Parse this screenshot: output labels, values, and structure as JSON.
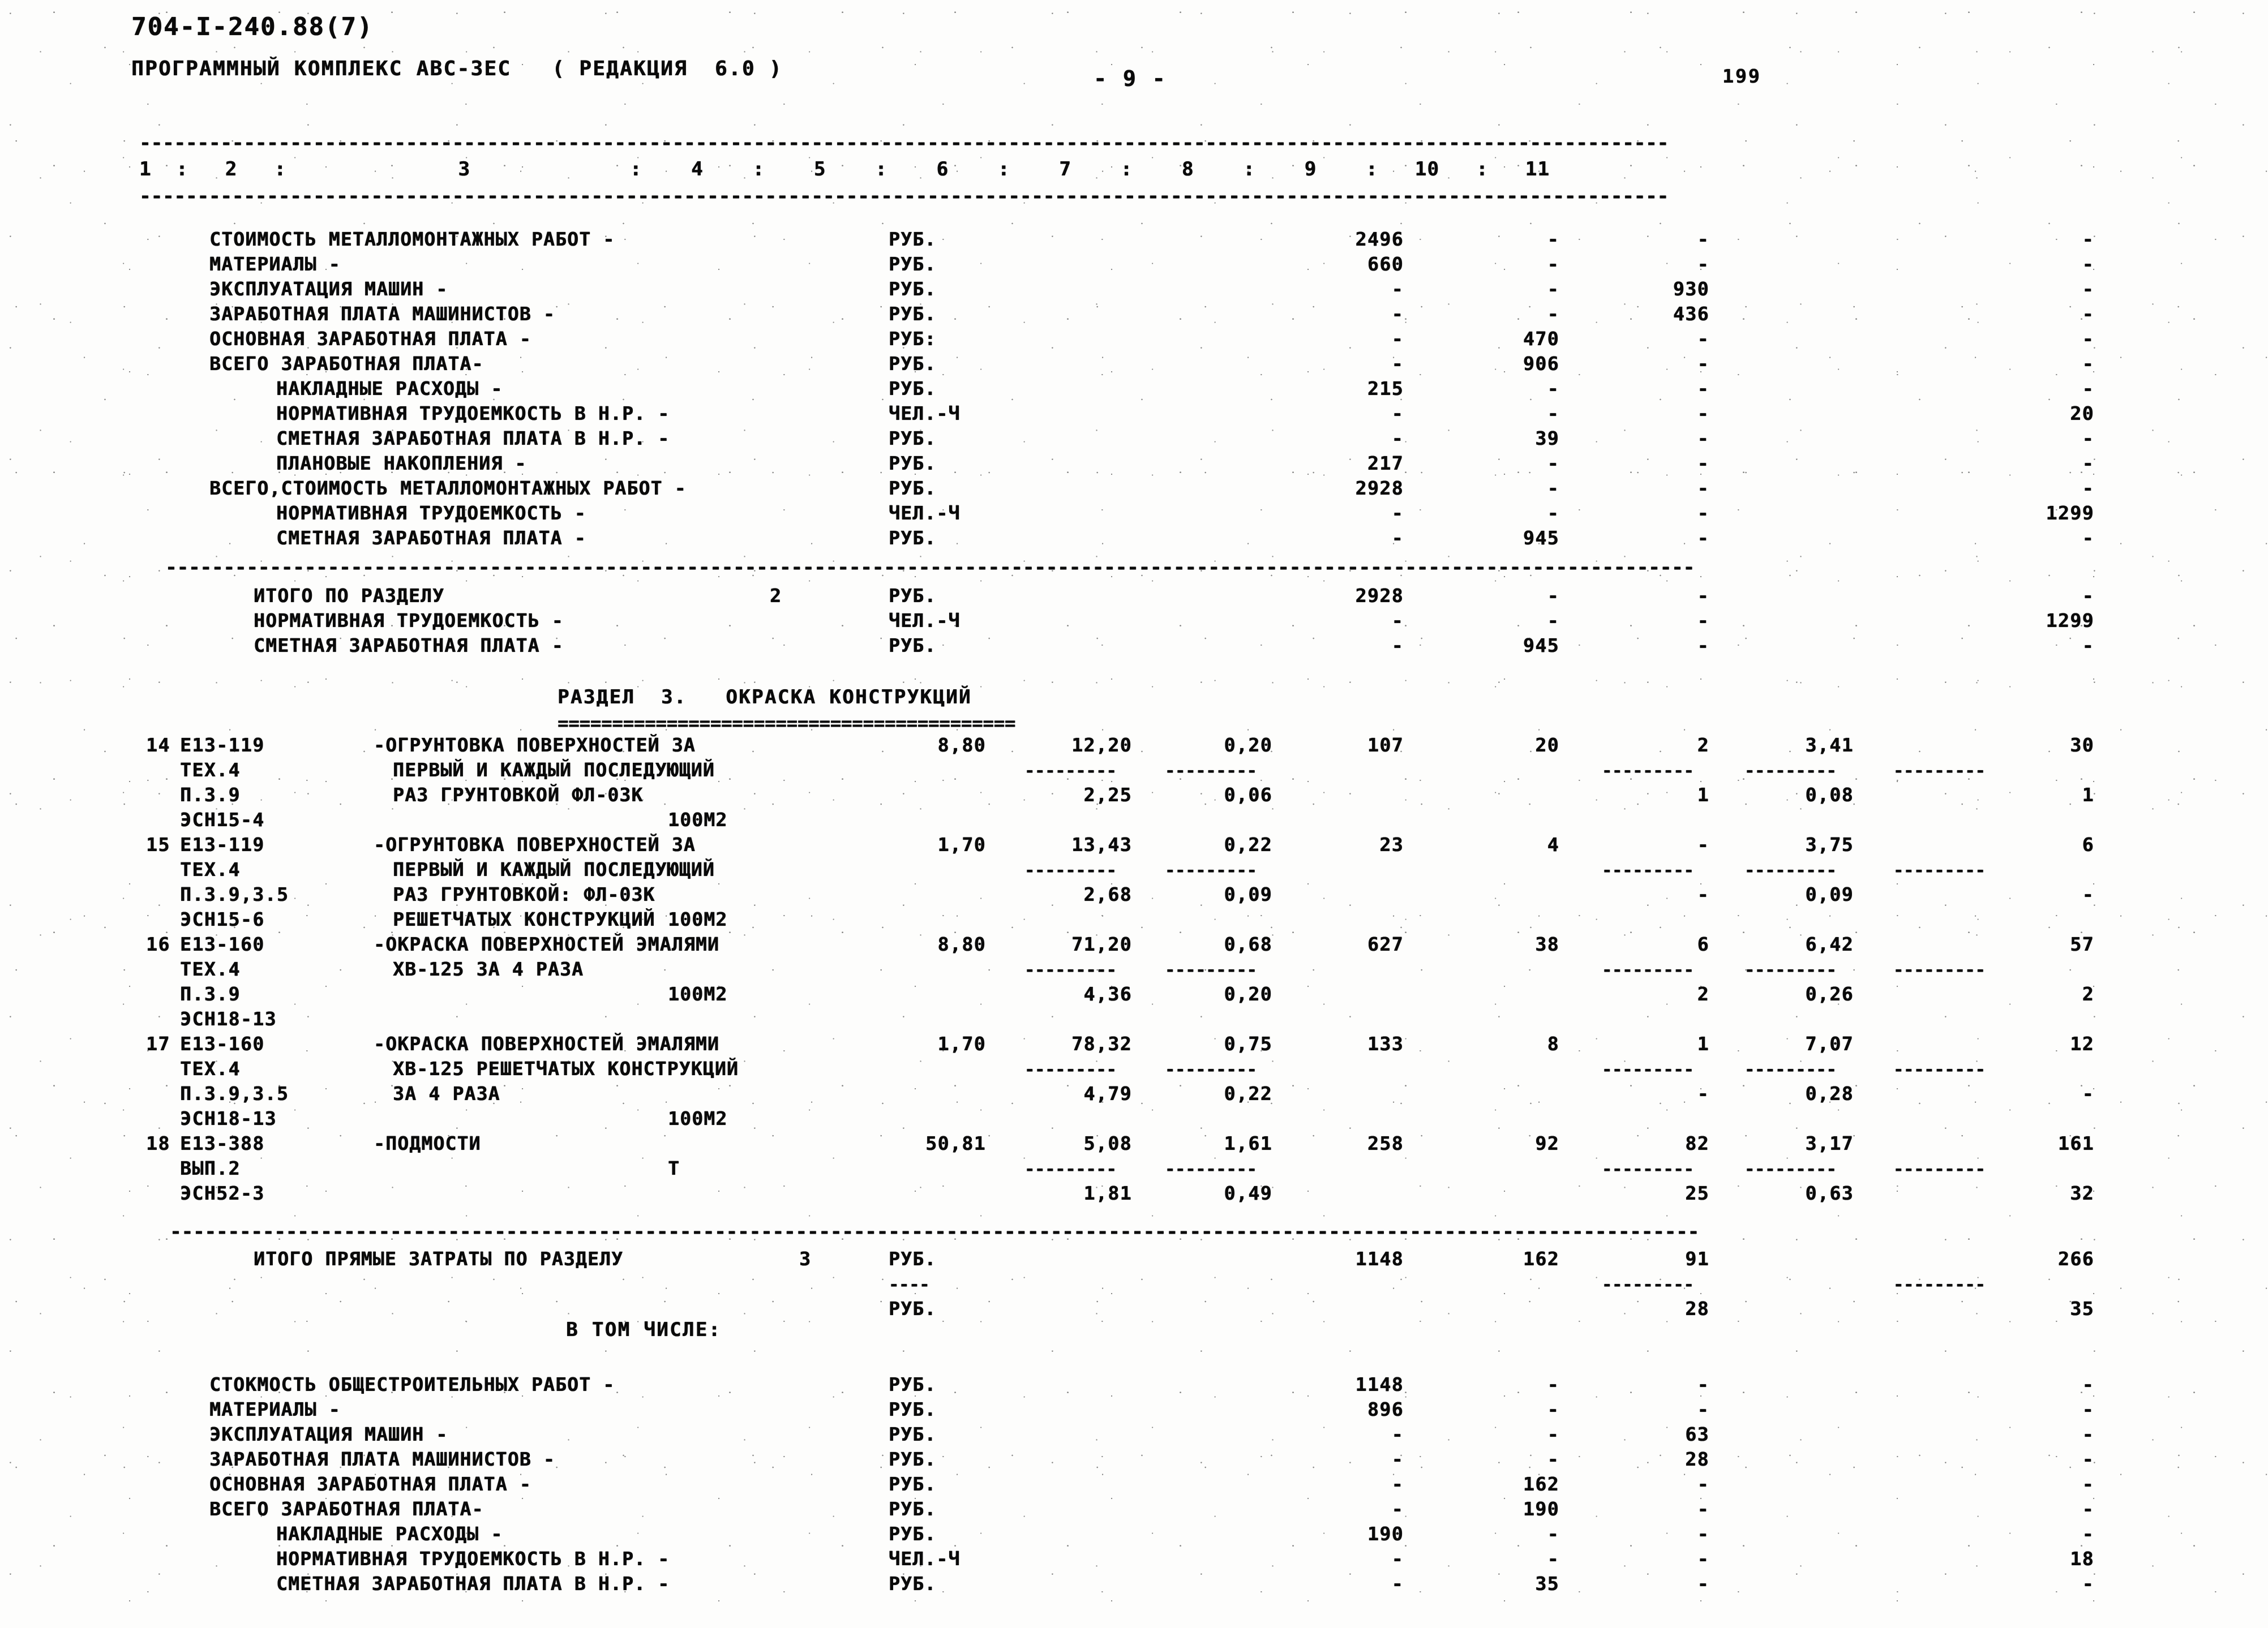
{
  "header": {
    "doc_code": "704-I-240.88(7)",
    "program_line": "ПРОГРАММНЫЙ КОМПЛЕКС АВС-3ЕС   ( РЕДАКЦИЯ  6.0 )",
    "page_marker": "- 9 -",
    "sheet_number": "199"
  },
  "column_numbers": "1  :   2   :              3             :    4    :    5    :    6    :    7    :    8    :    9    :   10   :   11",
  "rules": {
    "top": "------------------------------------------------------------------------------------------------------------------------------------",
    "eq": "==========================================",
    "dash_short": "---------",
    "short_dots": "----"
  },
  "block_metalwork": {
    "title": "",
    "lines": [
      {
        "label": "СТОИМОСТЬ МЕТАЛЛОМОНТАЖНЫХ РАБОТ -",
        "indent": 0,
        "unit": "РУБ.",
        "c7": "2496",
        "c8": "-",
        "c9": "-",
        "c10": "",
        "c11": "-"
      },
      {
        "label": "МАТЕРИАЛЫ -",
        "indent": 0,
        "unit": "РУБ.",
        "c7": "660",
        "c8": "-",
        "c9": "-",
        "c10": "",
        "c11": "-"
      },
      {
        "label": "ЭКСПЛУАТАЦИЯ МАШИН -",
        "indent": 0,
        "unit": "РУБ.",
        "c7": "-",
        "c8": "-",
        "c9": "930",
        "c10": "",
        "c11": "-"
      },
      {
        "label": "ЗАРАБОТНАЯ ПЛАТА МАШИНИСТОВ -",
        "indent": 0,
        "unit": "РУБ.",
        "c7": "-",
        "c8": "-",
        "c9": "436",
        "c10": "",
        "c11": "-"
      },
      {
        "label": "ОСНОВНАЯ ЗАРАБОТНАЯ ПЛАТА -",
        "indent": 0,
        "unit": "РУБ:",
        "c7": "-",
        "c8": "470",
        "c9": "-",
        "c10": "",
        "c11": "-"
      },
      {
        "label": "ВСЕГО ЗАРАБОТНАЯ ПЛАТА-",
        "indent": 0,
        "unit": "РУБ.",
        "c7": "-",
        "c8": "906",
        "c9": "-",
        "c10": "",
        "c11": "-"
      },
      {
        "label": "НАКЛАДНЫЕ РАСХОДЫ -",
        "indent": 1,
        "unit": "РУБ.",
        "c7": "215",
        "c8": "-",
        "c9": "-",
        "c10": "",
        "c11": "-"
      },
      {
        "label": "НОРМАТИВНАЯ ТРУДОЕМКОСТЬ В Н.Р. -",
        "indent": 1,
        "unit": "ЧЕЛ.-Ч",
        "c7": "-",
        "c8": "-",
        "c9": "-",
        "c10": "",
        "c11": "20"
      },
      {
        "label": "СМЕТНАЯ ЗАРАБОТНАЯ ПЛАТА В Н.Р. -",
        "indent": 1,
        "unit": "РУБ.",
        "c7": "-",
        "c8": "39",
        "c9": "-",
        "c10": "",
        "c11": "-"
      },
      {
        "label": "ПЛАНОВЫЕ НАКОПЛЕНИЯ -",
        "indent": 1,
        "unit": "РУБ.",
        "c7": "217",
        "c8": "-",
        "c9": "-",
        "c10": "",
        "c11": "-"
      },
      {
        "label": "ВСЕГО,СТОИМОСТЬ МЕТАЛЛОМОНТАЖНЫХ РАБОТ -",
        "indent": 0,
        "unit": "РУБ.",
        "c7": "2928",
        "c8": "-",
        "c9": "-",
        "c10": "",
        "c11": "-"
      },
      {
        "label": "НОРМАТИВНАЯ ТРУДОЕМКОСТЬ -",
        "indent": 1,
        "unit": "ЧЕЛ.-Ч",
        "c7": "-",
        "c8": "-",
        "c9": "-",
        "c10": "",
        "c11": "1299"
      },
      {
        "label": "СМЕТНАЯ ЗАРАБОТНАЯ ПЛАТА -",
        "indent": 1,
        "unit": "РУБ.",
        "c7": "-",
        "c8": "945",
        "c9": "-",
        "c10": "",
        "c11": "-"
      }
    ]
  },
  "block_total_section2": {
    "lines": [
      {
        "label": "ИТОГО ПО РАЗДЕЛУ",
        "section": "2",
        "unit": "РУБ.",
        "c7": "2928",
        "c8": "-",
        "c9": "-",
        "c11": "-"
      },
      {
        "label": "НОРМАТИВНАЯ ТРУДОЕМКОСТЬ -",
        "section": "",
        "unit": "ЧЕЛ.-Ч",
        "c7": "-",
        "c8": "-",
        "c9": "-",
        "c11": "1299"
      },
      {
        "label": "СМЕТНАЯ ЗАРАБОТНАЯ ПЛАТА -",
        "section": "",
        "unit": "РУБ.",
        "c7": "-",
        "c8": "945",
        "c9": "-",
        "c11": "-"
      }
    ]
  },
  "section3": {
    "title": "РАЗДЕЛ  3.   ОКРАСКА КОНСТРУКЦИЙ",
    "items": [
      {
        "no": "14",
        "codes": [
          "E13-119",
          "TEX.4",
          "П.3.9",
          "ЭСН15-4"
        ],
        "desc": [
          "-ОГРУНТОВКА ПОВЕРХНОСТЕЙ ЗА",
          "ПЕРВЫЙ И КАЖДЫЙ ПОСЛЕДУЮЩИЙ",
          "РАЗ ГРУНТОВКОЙ ФЛ-03К",
          ""
        ],
        "unit": "100М2",
        "c4": "8,80",
        "c5a": "12,20",
        "c5b": "2,25",
        "c6a": "0,20",
        "c6b": "0,06",
        "c7": "107",
        "c8": "20",
        "c9a": "2",
        "c9b": "1",
        "c10a": "3,41",
        "c10b": "0,08",
        "c11a": "30",
        "c11b": "1"
      },
      {
        "no": "15",
        "codes": [
          "E13-119",
          "TEX.4",
          "П.3.9,3.5",
          "ЭСН15-6"
        ],
        "desc": [
          "-ОГРУНТОВКА ПОВЕРХНОСТЕЙ ЗА",
          "ПЕРВЫЙ И КАЖДЫЙ ПОСЛЕДУЮЩИЙ",
          "РАЗ ГРУНТОВКОЙ: ФЛ-03К",
          "РЕШЕТЧАТЫХ КОНСТРУКЦИЙ"
        ],
        "unit": "100М2",
        "c4": "1,70",
        "c5a": "13,43",
        "c5b": "2,68",
        "c6a": "0,22",
        "c6b": "0,09",
        "c7": "23",
        "c8": "4",
        "c9a": "-",
        "c9b": "-",
        "c10a": "3,75",
        "c10b": "0,09",
        "c11a": "6",
        "c11b": "-"
      },
      {
        "no": "16",
        "codes": [
          "E13-160",
          "TEX.4",
          "П.3.9",
          "ЭСН18-13"
        ],
        "desc": [
          "-ОКРАСКА ПОВЕРХНОСТЕЙ ЭМАЛЯМИ",
          "ХВ-125 ЗА 4 РАЗА",
          "",
          ""
        ],
        "unit": "100М2",
        "c4": "8,80",
        "c5a": "71,20",
        "c5b": "4,36",
        "c6a": "0,68",
        "c6b": "0,20",
        "c7": "627",
        "c8": "38",
        "c9a": "6",
        "c9b": "2",
        "c10a": "6,42",
        "c10b": "0,26",
        "c11a": "57",
        "c11b": "2"
      },
      {
        "no": "17",
        "codes": [
          "E13-160",
          "TEX.4",
          "П.3.9,3.5",
          "ЭСН18-13"
        ],
        "desc": [
          "-ОКРАСКА ПОВЕРХНОСТЕЙ ЭМАЛЯМИ",
          "ХВ-125 РЕШЕТЧАТЫХ КОНСТРУКЦИЙ",
          "ЗА 4 РАЗА",
          ""
        ],
        "unit": "100М2",
        "c4": "1,70",
        "c5a": "78,32",
        "c5b": "4,79",
        "c6a": "0,75",
        "c6b": "0,22",
        "c7": "133",
        "c8": "8",
        "c9a": "1",
        "c9b": "-",
        "c10a": "7,07",
        "c10b": "0,28",
        "c11a": "12",
        "c11b": "-"
      },
      {
        "no": "18",
        "codes": [
          "E13-388",
          "ВЫП.2",
          "ЭСН52-3",
          ""
        ],
        "desc": [
          "-ПОДМОСТИ",
          "",
          "",
          ""
        ],
        "unit": "Т",
        "c4": "50,81",
        "c5a": "5,08",
        "c5b": "1,81",
        "c6a": "1,61",
        "c6b": "0,49",
        "c7": "258",
        "c8": "92",
        "c9a": "82",
        "c9b": "25",
        "c10a": "3,17",
        "c10b": "0,63",
        "c11a": "161",
        "c11b": "32"
      }
    ]
  },
  "block_total_section3": {
    "label": "ИТОГО ПРЯМЫЕ ЗАТРАТЫ ПО РАЗДЕЛУ",
    "section": "3",
    "unit_a": "РУБ.",
    "unit_b": "РУБ.",
    "row_a": {
      "c7": "1148",
      "c8": "162",
      "c9": "91",
      "c11": "266"
    },
    "row_b": {
      "c7": "",
      "c8": "",
      "c9": "28",
      "c11": "35"
    }
  },
  "in_which_label": "В ТОМ ЧИСЛЕ:",
  "block_general": {
    "lines": [
      {
        "label": "СТОКМОСТЬ ОБЩЕСТРОИТЕЛЬНЫХ РАБОТ -",
        "indent": 0,
        "unit": "РУБ.",
        "c7": "1148",
        "c8": "-",
        "c9": "-",
        "c11": "-"
      },
      {
        "label": "МАТЕРИАЛЫ -",
        "indent": 0,
        "unit": "РУБ.",
        "c7": "896",
        "c8": "-",
        "c9": "-",
        "c11": "-"
      },
      {
        "label": "ЭКСПЛУАТАЦИЯ МАШИН -",
        "indent": 0,
        "unit": "РУБ.",
        "c7": "-",
        "c8": "-",
        "c9": "63",
        "c11": "-"
      },
      {
        "label": "ЗАРАБОТНАЯ ПЛАТА МАШИНИСТОВ -",
        "indent": 0,
        "unit": "РУБ.",
        "c7": "-",
        "c8": "-",
        "c9": "28",
        "c11": "-"
      },
      {
        "label": "ОСНОВНАЯ ЗАРАБОТНАЯ ПЛАТА -",
        "indent": 0,
        "unit": "РУБ.",
        "c7": "-",
        "c8": "162",
        "c9": "-",
        "c11": "-"
      },
      {
        "label": "ВСЕГО ЗАРАБОТНАЯ ПЛАТА-",
        "indent": 0,
        "unit": "РУБ.",
        "c7": "-",
        "c8": "190",
        "c9": "-",
        "c11": "-"
      },
      {
        "label": "НАКЛАДНЫЕ РАСХОДЫ -",
        "indent": 1,
        "unit": "РУБ.",
        "c7": "190",
        "c8": "-",
        "c9": "-",
        "c11": "-"
      },
      {
        "label": "НОРМАТИВНАЯ ТРУДОЕМКОСТЬ В Н.Р. -",
        "indent": 1,
        "unit": "ЧЕЛ.-Ч",
        "c7": "-",
        "c8": "-",
        "c9": "-",
        "c11": "18"
      },
      {
        "label": "СМЕТНАЯ ЗАРАБОТНАЯ ПЛАТА В Н.Р. -",
        "indent": 1,
        "unit": "РУБ.",
        "c7": "-",
        "c8": "35",
        "c9": "-",
        "c11": "-"
      }
    ]
  }
}
